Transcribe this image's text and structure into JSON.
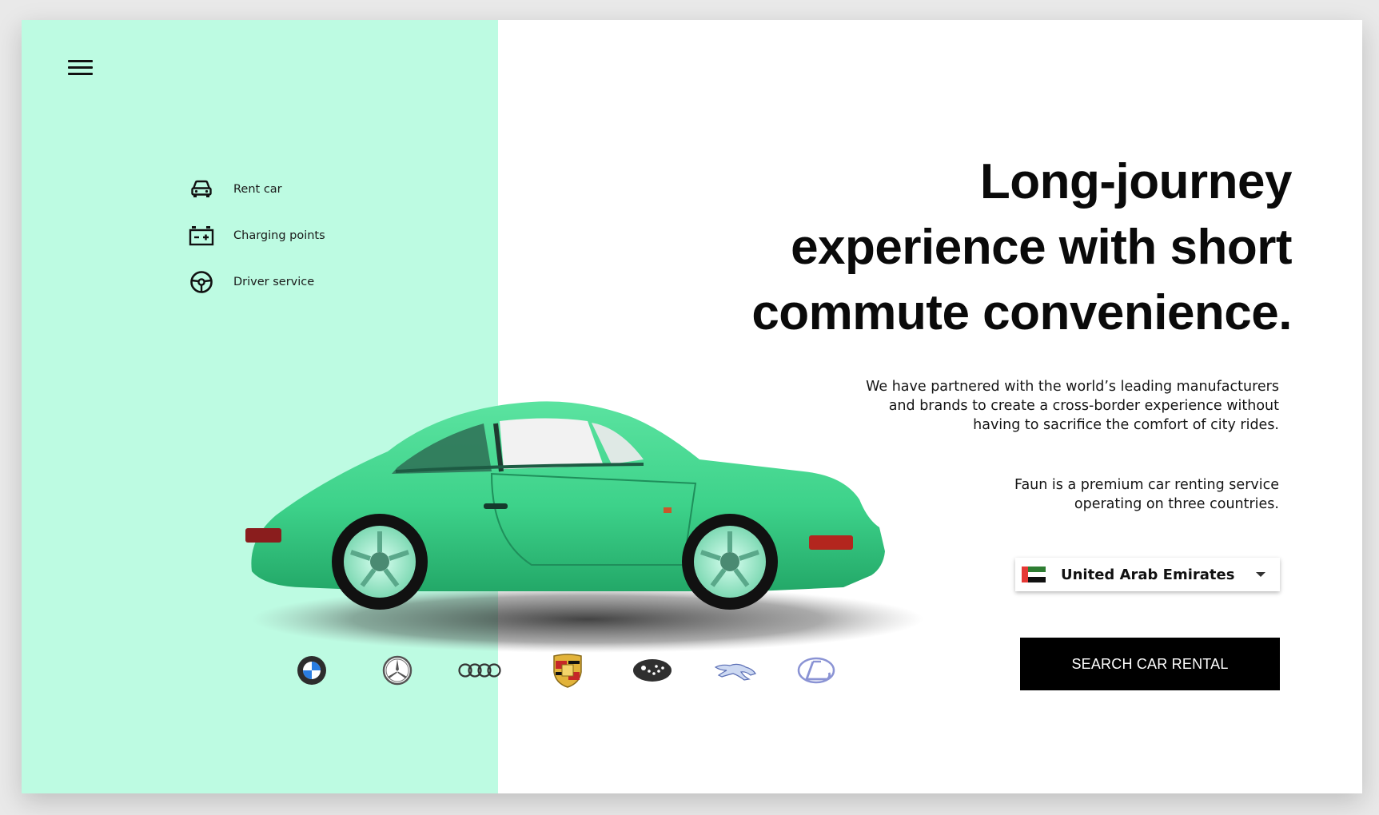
{
  "nav": {
    "menu_icon": "hamburger-icon",
    "items": [
      {
        "label": "Rent car",
        "icon": "car-icon"
      },
      {
        "label": "Charging points",
        "icon": "battery-icon"
      },
      {
        "label": "Driver service",
        "icon": "steering-wheel-icon"
      }
    ]
  },
  "hero": {
    "headline_lines": [
      "Long-journey",
      "experience with short",
      "commute convenience."
    ],
    "description_lines": [
      "We have partnered with the world’s leading manufacturers",
      "and brands to create a cross-border experience without",
      "having to sacrifice the comfort of city rides."
    ],
    "tagline_lines": [
      "Faun is a premium car renting service",
      "operating on three countries."
    ]
  },
  "country_select": {
    "value": "United Arab Emirates",
    "flag_icon": "uae-flag-icon"
  },
  "search_button": {
    "label": "SEARCH CAR RENTAL"
  },
  "brands": [
    "BMW",
    "Mercedes-Benz",
    "Audi",
    "Porsche",
    "Subaru",
    "Jaguar",
    "Lexus"
  ],
  "colors": {
    "mint_panel": "#bdfbe2",
    "car_body": "#3dd28a",
    "button_bg": "#000000"
  }
}
